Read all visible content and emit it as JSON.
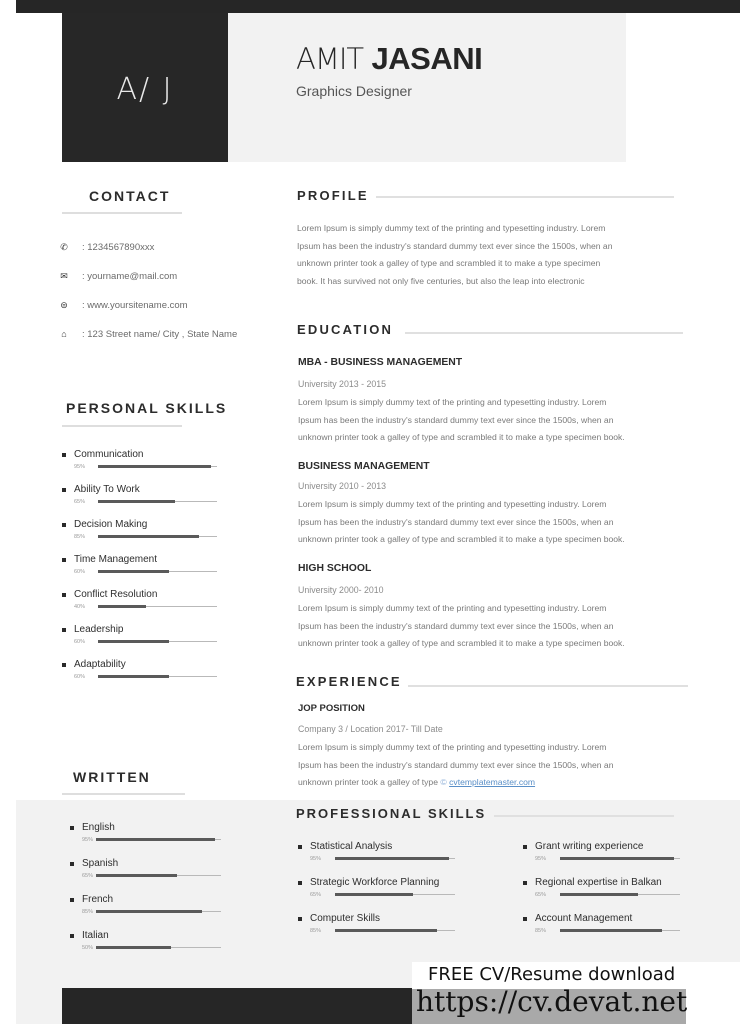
{
  "header": {
    "initials": "A/ J",
    "first_name": "AMIT",
    "last_name": "JASANI",
    "job_title": "Graphics Designer"
  },
  "contact": {
    "heading": "CONTACT",
    "items": [
      {
        "icon": "phone-icon",
        "glyph": "✆",
        "text": ": 1234567890xxx"
      },
      {
        "icon": "email-icon",
        "glyph": "✉",
        "text": ": yourname@mail.com"
      },
      {
        "icon": "globe-icon",
        "glyph": "⊜",
        "text": ": www.yoursitename.com"
      },
      {
        "icon": "home-icon",
        "glyph": "⌂",
        "text": ": 123 Street name/ City , State Name"
      }
    ]
  },
  "personal_skills": {
    "heading": "PERSONAL SKILLS",
    "items": [
      {
        "label": "Communication",
        "pct_label": "95%",
        "value": 95
      },
      {
        "label": "Ability To Work",
        "pct_label": "65%",
        "value": 65
      },
      {
        "label": "Decision Making",
        "pct_label": "85%",
        "value": 85
      },
      {
        "label": "Time Management",
        "pct_label": "60%",
        "value": 60
      },
      {
        "label": "Conflict Resolution",
        "pct_label": "40%",
        "value": 40
      },
      {
        "label": "Leadership",
        "pct_label": "60%",
        "value": 60
      },
      {
        "label": "Adaptability",
        "pct_label": "60%",
        "value": 60
      }
    ]
  },
  "written": {
    "heading": "WRITTEN",
    "items": [
      {
        "label": "English",
        "pct_label": "95%",
        "value": 95
      },
      {
        "label": "Spanish",
        "pct_label": "65%",
        "value": 65
      },
      {
        "label": "French",
        "pct_label": "85%",
        "value": 85
      },
      {
        "label": "Italian",
        "pct_label": "50%",
        "value": 60
      }
    ]
  },
  "profile": {
    "heading": "PROFILE",
    "lines": [
      "Lorem Ipsum is simply dummy text of the printing and typesetting industry. Lorem",
      "Ipsum has been the industry's standard dummy text ever since the 1500s, when an",
      "unknown printer took a galley of type and scrambled it to make a type specimen",
      "book. It has survived not only five centuries, but also the leap into electronic"
    ]
  },
  "education": {
    "heading": "EDUCATION",
    "entries": [
      {
        "title": "MBA - BUSINESS MANAGEMENT",
        "sub": "University  2013 - 2015",
        "lines": [
          "Lorem Ipsum is simply dummy text of the printing and typesetting industry. Lorem",
          "Ipsum has been the industry's standard dummy text ever since the 1500s, when an",
          "unknown printer took a galley of type and scrambled it to make a type specimen book."
        ]
      },
      {
        "title": "BUSINESS MANAGEMENT",
        "sub": "University 2010 - 2013",
        "lines": [
          "Lorem Ipsum is simply dummy text of the printing and typesetting industry. Lorem",
          "Ipsum has been the industry's standard dummy text ever since the 1500s, when an",
          "unknown printer took a galley of type and scrambled it to make a type specimen book."
        ]
      },
      {
        "title": "HIGH SCHOOL",
        "sub": "University  2000- 2010",
        "lines": [
          "Lorem Ipsum is simply dummy text of the printing and typesetting industry. Lorem",
          "Ipsum has been the industry's standard dummy text ever since the 1500s, when an",
          "unknown printer took a galley of type and scrambled it to make a type specimen book."
        ]
      }
    ]
  },
  "experience": {
    "heading": "EXPERIENCE",
    "title": "JOP POSITION",
    "sub": "Company 3 / Location 2017- Till Date",
    "lines": [
      "Lorem Ipsum is simply dummy text of the printing and typesetting industry. Lorem",
      "Ipsum has been the industry's standard dummy text ever since the 1500s, when an"
    ],
    "last_line_prefix": "unknown printer took a galley of type ",
    "copyright": "©",
    "link_text": "cvtemplatemaster.com"
  },
  "professional_skills": {
    "heading": "PROFESSIONAL SKILLS",
    "left": [
      {
        "label": "Statistical Analysis",
        "pct_label": "95%",
        "value": 95
      },
      {
        "label": "Strategic Workforce Planning",
        "pct_label": "65%",
        "value": 65
      },
      {
        "label": "Computer Skills",
        "pct_label": "85%",
        "value": 85
      }
    ],
    "right": [
      {
        "label": "Grant writing experience",
        "pct_label": "95%",
        "value": 95
      },
      {
        "label": "Regional expertise in Balkan",
        "pct_label": "65%",
        "value": 65
      },
      {
        "label": "Account Management",
        "pct_label": "85%",
        "value": 85
      }
    ]
  },
  "watermark": {
    "line1": "FREE CV/Resume download",
    "line2": "https://cv.devat.net"
  }
}
